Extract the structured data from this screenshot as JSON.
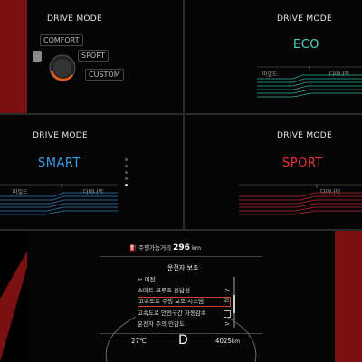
{
  "panels": {
    "top_left": {
      "title": "DRIVE MODE",
      "options": [
        "COMFORT",
        "SPORT",
        "CUSTOM"
      ]
    },
    "top_right": {
      "title": "DRIVE MODE",
      "mode": "ECO",
      "mode_color": "#3fd6c4",
      "left_label": "마일드",
      "right_label": "다이나믹"
    },
    "mid_left": {
      "title": "DRIVE MODE",
      "mode": "SMART",
      "mode_color": "#3aa0e8",
      "left_label": "마일드",
      "right_label": "다이나믹"
    },
    "mid_right": {
      "title": "DRIVE MODE",
      "mode": "SPORT",
      "mode_color": "#e8323a",
      "left_label": "",
      "right_label": "다이나믹"
    }
  },
  "cluster": {
    "range_label": "주행가능거리",
    "range_value": "296",
    "range_unit": "km",
    "menu_title": "운전자 보조",
    "menu_items": [
      {
        "label": "이전",
        "control": "none"
      },
      {
        "label": "스마트 크루즈 응답성",
        "control": "arrow"
      },
      {
        "label": "고속도로 주행 보조 시스템",
        "control": "checked"
      },
      {
        "label": "고속도로 안전구간 자동감속",
        "control": "unchecked"
      },
      {
        "label": "운전자 주의 민감도",
        "control": "arrow"
      }
    ],
    "temperature": "27℃",
    "gear": "D",
    "odometer_value": "4025",
    "odometer_unit": "km"
  }
}
